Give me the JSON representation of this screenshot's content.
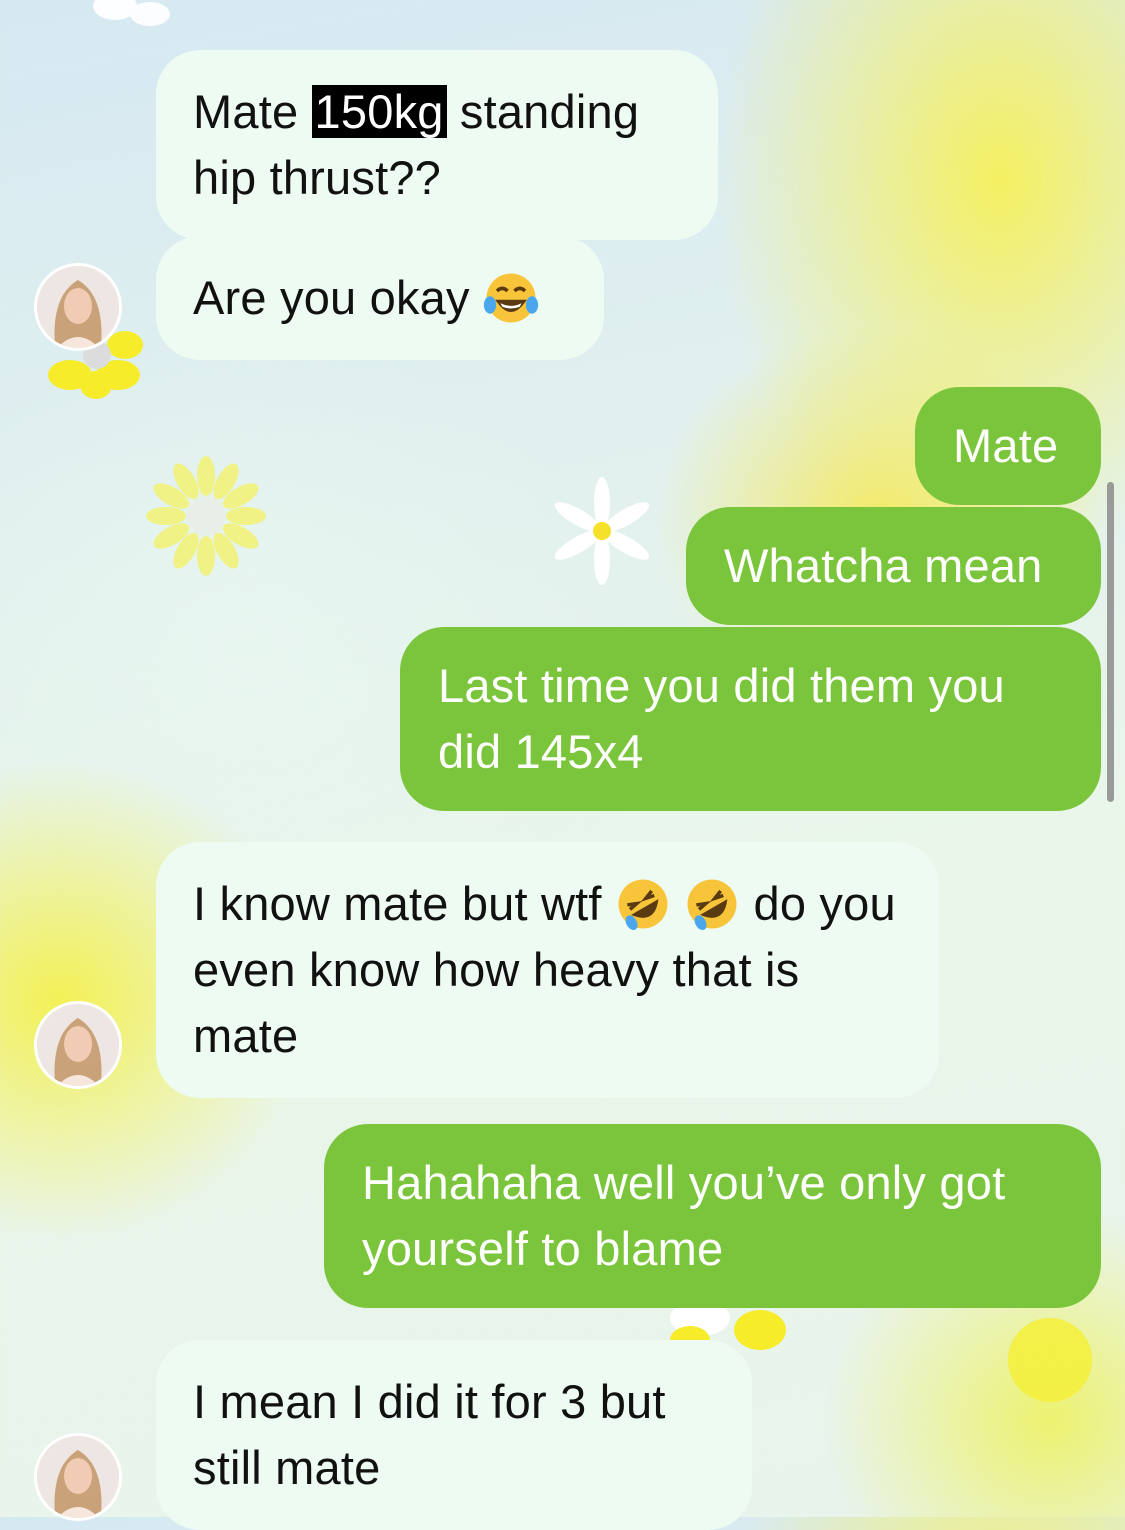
{
  "conversation": {
    "messages": [
      {
        "id": "m1",
        "sender": "contact",
        "parts": [
          "Mate ",
          "150kg",
          " standing hip thrust??"
        ]
      },
      {
        "id": "m2",
        "sender": "contact",
        "text": "Are you okay",
        "emoji": "face-with-tears-of-joy"
      },
      {
        "id": "m3",
        "sender": "me",
        "text": "Mate"
      },
      {
        "id": "m4",
        "sender": "me",
        "text": "Whatcha mean"
      },
      {
        "id": "m5",
        "sender": "me",
        "text": "Last time you did them you did 145x4"
      },
      {
        "id": "m6",
        "sender": "contact",
        "parts": [
          "I know mate but wtf ",
          " do you even know how heavy that is mate"
        ],
        "emojis": [
          "rolling-on-floor-laughing",
          "rolling-on-floor-laughing"
        ]
      },
      {
        "id": "m7",
        "sender": "me",
        "text": "Hahahaha well you’ve only got yourself to blame"
      },
      {
        "id": "m8",
        "sender": "contact",
        "text": "I mean I did it for 3 but still mate"
      }
    ]
  },
  "theme": {
    "incoming_bubble": "#edfbf3",
    "outgoing_bubble": "#7ac53b",
    "accent_yellow": "#f4ef5a",
    "highlight": "#000000"
  }
}
